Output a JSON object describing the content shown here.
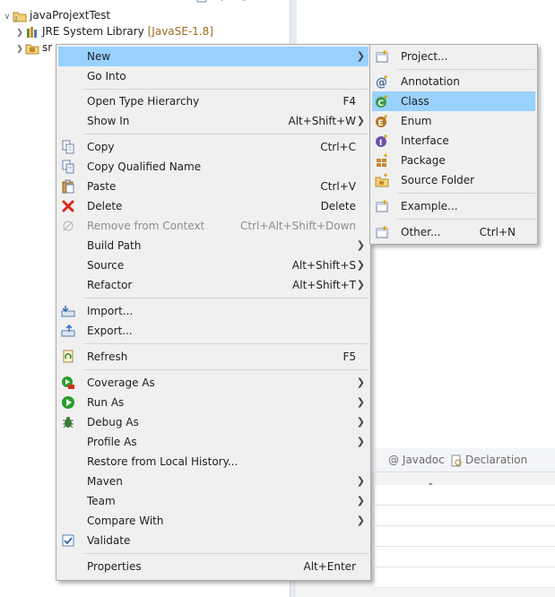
{
  "explorer": {
    "project_name": "javaProjextTest",
    "jre_label": "JRE System Library",
    "jre_decoration": "[JavaSE-1.8]",
    "src_label_partial": "sr"
  },
  "lower_pane": {
    "tabs": [
      {
        "label": "Javadoc",
        "prefix": "@"
      },
      {
        "label": "Declaration"
      }
    ]
  },
  "context_menu": {
    "items": [
      {
        "label": "New",
        "accelerator": "",
        "submenu": true,
        "icon": "none",
        "selected": true
      },
      {
        "label": "Go Into",
        "accelerator": "",
        "icon": "none"
      },
      {
        "label": "Open Type Hierarchy",
        "accelerator": "F4",
        "icon": "none"
      },
      {
        "label": "Show In",
        "accelerator": "Alt+Shift+W",
        "submenu": true,
        "icon": "none"
      },
      {
        "label": "Copy",
        "accelerator": "Ctrl+C",
        "icon": "copy-icon"
      },
      {
        "label": "Copy Qualified Name",
        "accelerator": "",
        "icon": "copy-qualified-icon"
      },
      {
        "label": "Paste",
        "accelerator": "Ctrl+V",
        "icon": "paste-icon"
      },
      {
        "label": "Delete",
        "accelerator": "Delete",
        "icon": "delete-icon"
      },
      {
        "label": "Remove from Context",
        "accelerator": "Ctrl+Alt+Shift+Down",
        "icon": "remove-context-icon",
        "disabled": true
      },
      {
        "label": "Build Path",
        "accelerator": "",
        "submenu": true,
        "icon": "none"
      },
      {
        "label": "Source",
        "accelerator": "Alt+Shift+S",
        "submenu": true,
        "icon": "none"
      },
      {
        "label": "Refactor",
        "accelerator": "Alt+Shift+T",
        "submenu": true,
        "icon": "none"
      },
      {
        "label": "Import...",
        "accelerator": "",
        "icon": "import-icon"
      },
      {
        "label": "Export...",
        "accelerator": "",
        "icon": "export-icon"
      },
      {
        "label": "Refresh",
        "accelerator": "F5",
        "icon": "refresh-icon"
      },
      {
        "label": "Coverage As",
        "accelerator": "",
        "submenu": true,
        "icon": "coverage-icon"
      },
      {
        "label": "Run As",
        "accelerator": "",
        "submenu": true,
        "icon": "run-icon"
      },
      {
        "label": "Debug As",
        "accelerator": "",
        "submenu": true,
        "icon": "debug-icon"
      },
      {
        "label": "Profile As",
        "accelerator": "",
        "submenu": true,
        "icon": "none"
      },
      {
        "label": "Restore from Local History...",
        "accelerator": "",
        "icon": "none"
      },
      {
        "label": "Maven",
        "accelerator": "",
        "submenu": true,
        "icon": "none"
      },
      {
        "label": "Team",
        "accelerator": "",
        "submenu": true,
        "icon": "none"
      },
      {
        "label": "Compare With",
        "accelerator": "",
        "submenu": true,
        "icon": "none"
      },
      {
        "label": "Validate",
        "accelerator": "",
        "icon": "checkbox-icon"
      },
      {
        "label": "Properties",
        "accelerator": "Alt+Enter",
        "icon": "none"
      }
    ]
  },
  "new_submenu": {
    "items": [
      {
        "label": "Project...",
        "accelerator": "",
        "icon": "new-project-icon"
      },
      {
        "label": "Annotation",
        "accelerator": "",
        "icon": "annotation-icon"
      },
      {
        "label": "Class",
        "accelerator": "",
        "icon": "class-icon",
        "selected": true
      },
      {
        "label": "Enum",
        "accelerator": "",
        "icon": "enum-icon"
      },
      {
        "label": "Interface",
        "accelerator": "",
        "icon": "interface-icon"
      },
      {
        "label": "Package",
        "accelerator": "",
        "icon": "package-icon"
      },
      {
        "label": "Source Folder",
        "accelerator": "",
        "icon": "source-folder-icon"
      },
      {
        "label": "Example...",
        "accelerator": "",
        "icon": "example-icon"
      },
      {
        "label": "Other...",
        "accelerator": "Ctrl+N",
        "icon": "other-icon"
      }
    ]
  },
  "colors": {
    "menu_bg": "#f0f0f0",
    "selection": "#99d1ff",
    "disabled_text": "#8d8d8d",
    "jre_decoration": "#9c6a18"
  }
}
